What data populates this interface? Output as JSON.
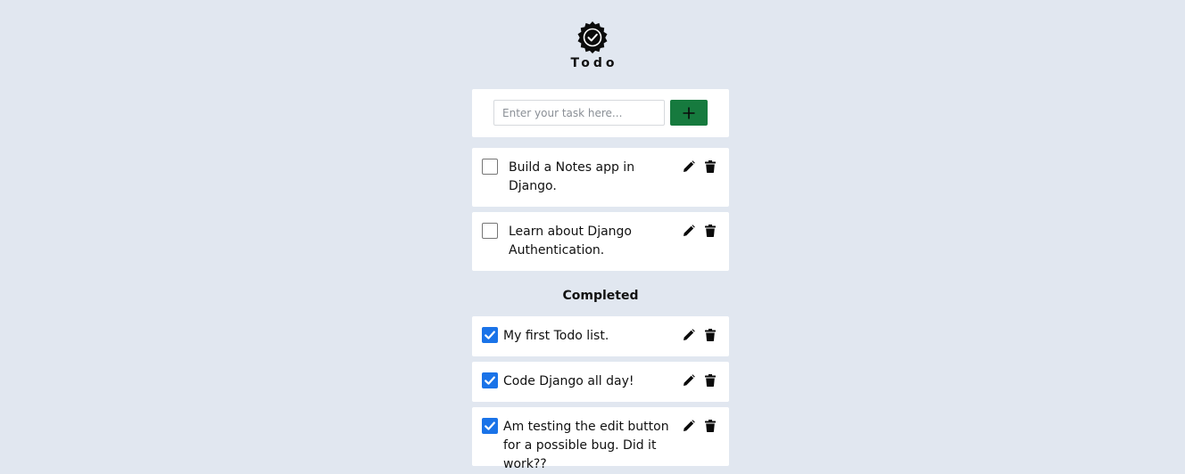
{
  "app": {
    "title": "Todo",
    "logo_icon": "check-badge-icon"
  },
  "form": {
    "input_value": "",
    "input_placeholder": "Enter your task here...",
    "add_button_icon": "plus-icon",
    "add_button_color": "#167a3e"
  },
  "pending": [
    {
      "text": "Build a Notes app in Django.",
      "checked": false
    },
    {
      "text": "Learn about Django Authentication.",
      "checked": false
    }
  ],
  "completed_heading": "Completed",
  "completed": [
    {
      "text": "My first Todo list.",
      "checked": true
    },
    {
      "text": "Code Django all day!",
      "checked": true
    },
    {
      "text": "Am testing the edit button for a possible bug. Did it work??",
      "checked": true
    }
  ],
  "icons": {
    "edit": "pencil-icon",
    "delete": "trash-icon",
    "check": "checkmark-icon"
  },
  "colors": {
    "background": "#e1e7f0",
    "card": "#ffffff",
    "checkbox_checked": "#1a73e8"
  }
}
